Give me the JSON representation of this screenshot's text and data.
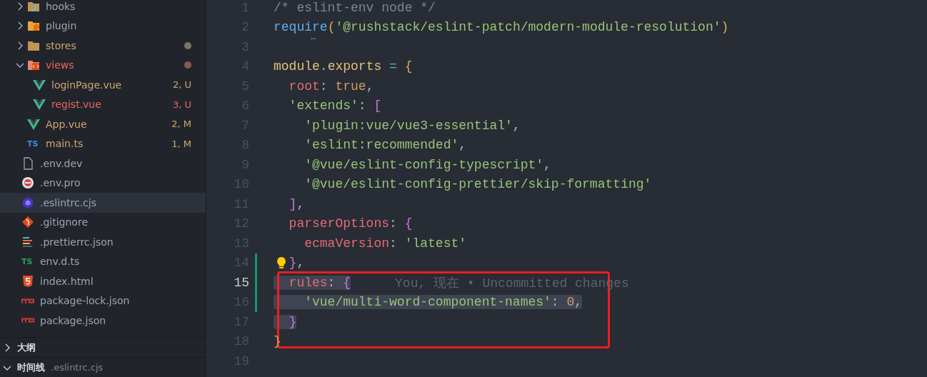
{
  "explorer": {
    "src_items": [
      {
        "name": "hooks",
        "kind": "folder-hooks",
        "expanded": false,
        "color": "#9da5b4"
      },
      {
        "name": "plugin",
        "kind": "folder-plugin",
        "expanded": false,
        "color": "#9da5b4"
      },
      {
        "name": "stores",
        "kind": "folder",
        "expanded": false,
        "color": "#cfa56f",
        "dot": {
          "color": "#7d7565"
        }
      },
      {
        "name": "views",
        "kind": "folder-views",
        "expanded": true,
        "color": "#e8685f",
        "dot": {
          "color": "#8c5852"
        },
        "children": [
          {
            "name": "loginPage.vue",
            "kind": "vue",
            "color": "#cfa56f",
            "badge": "2, U"
          },
          {
            "name": "regist.vue",
            "kind": "vue",
            "color": "#e8685f",
            "badge": "3, U"
          }
        ]
      },
      {
        "name": "App.vue",
        "kind": "vue",
        "color": "#cfa56f",
        "badge": "2, M"
      },
      {
        "name": "main.ts",
        "kind": "ts",
        "icon_text": "TS",
        "color": "#cfa56f",
        "badge": "1, M"
      }
    ],
    "root_items": [
      {
        "name": ".env.dev",
        "kind": "file",
        "selected": false
      },
      {
        "name": ".env.pro",
        "kind": "env-pro",
        "selected": false
      },
      {
        "name": ".eslintrc.cjs",
        "kind": "eslint",
        "selected": true
      },
      {
        "name": ".gitignore",
        "kind": "git",
        "selected": false
      },
      {
        "name": ".prettierrc.json",
        "kind": "prettier",
        "selected": false
      },
      {
        "name": "env.d.ts",
        "kind": "ts-green",
        "icon_text": "TS",
        "selected": false
      },
      {
        "name": "index.html",
        "kind": "html",
        "selected": false
      },
      {
        "name": "package-lock.json",
        "kind": "npm",
        "selected": false
      },
      {
        "name": "package.json",
        "kind": "npm",
        "selected": false
      }
    ]
  },
  "panels": [
    {
      "title": "大纲",
      "expanded": false
    },
    {
      "title": "时间线",
      "expanded": true,
      "subtitle": ".eslintrc.cjs"
    }
  ],
  "editor": {
    "lines": [
      {
        "number": "1",
        "current": false,
        "selected": false,
        "kind": "top",
        "tokens": [
          {
            "text": "/* eslint-env node */",
            "kind": "comment"
          }
        ]
      },
      {
        "number": "2",
        "current": false,
        "selected": false,
        "hint": "…",
        "kind": "top",
        "tokens": [
          {
            "text": "require",
            "kind": "func"
          },
          {
            "text": "(",
            "kind": "paren"
          },
          {
            "text": "'@rushstack/eslint-patch/modern-module-resolution'",
            "kind": "string"
          },
          {
            "text": ")",
            "kind": "paren"
          }
        ]
      },
      {
        "number": "3",
        "current": false
      },
      {
        "number": "4",
        "current": false,
        "selected": false,
        "kind": "top",
        "tokens": [
          {
            "text": "module",
            "kind": "var"
          },
          {
            "text": ".",
            "kind": "punct"
          },
          {
            "text": "exports",
            "kind": "var"
          },
          {
            "text": " = ",
            "kind": "op"
          },
          {
            "text": "{",
            "kind": "brace1"
          }
        ]
      },
      {
        "number": "5",
        "current": false,
        "selected": false,
        "kind": "inner",
        "tokens": [
          {
            "text": "root",
            "kind": "key"
          },
          {
            "text": ": ",
            "kind": "punct"
          },
          {
            "text": "true",
            "kind": "bool"
          },
          {
            "text": ",",
            "kind": "punct"
          }
        ]
      },
      {
        "number": "6",
        "current": false,
        "selected": false,
        "kind": "inner",
        "tokens": [
          {
            "text": "'extends'",
            "kind": "string"
          },
          {
            "text": ": ",
            "kind": "punct"
          },
          {
            "text": "[",
            "kind": "brace2"
          }
        ]
      },
      {
        "number": "7",
        "current": false,
        "selected": false,
        "kind": "deep",
        "tokens": [
          {
            "text": "'plugin:vue/vue3-essential'",
            "kind": "string"
          },
          {
            "text": ",",
            "kind": "punct"
          }
        ]
      },
      {
        "number": "8",
        "current": false,
        "selected": false,
        "kind": "deep",
        "tokens": [
          {
            "text": "'eslint:recommended'",
            "kind": "string"
          },
          {
            "text": ",",
            "kind": "punct"
          }
        ]
      },
      {
        "number": "9",
        "current": false,
        "selected": false,
        "kind": "deep",
        "tokens": [
          {
            "text": "'@vue/eslint-config-typescript'",
            "kind": "string"
          },
          {
            "text": ",",
            "kind": "punct"
          }
        ]
      },
      {
        "number": "10",
        "current": false,
        "selected": false,
        "kind": "deep",
        "tokens": [
          {
            "text": "'@vue/eslint-config-prettier/skip-formatting'",
            "kind": "string"
          }
        ]
      },
      {
        "number": "11",
        "current": false,
        "selected": false,
        "kind": "inner",
        "tokens": [
          {
            "text": "]",
            "kind": "brace2"
          },
          {
            "text": ",",
            "kind": "punct"
          }
        ]
      },
      {
        "number": "12",
        "current": false,
        "selected": false,
        "kind": "inner",
        "tokens": [
          {
            "text": "parserOptions",
            "kind": "key"
          },
          {
            "text": ": ",
            "kind": "punct"
          },
          {
            "text": "{",
            "kind": "brace2"
          }
        ]
      },
      {
        "number": "13",
        "current": false,
        "selected": false,
        "kind": "deep",
        "tokens": [
          {
            "text": "ecmaVersion",
            "kind": "key"
          },
          {
            "text": ": ",
            "kind": "punct"
          },
          {
            "text": "'latest'",
            "kind": "string"
          }
        ]
      },
      {
        "number": "14",
        "current": false,
        "selected": false,
        "lightbulb": true,
        "changed": true,
        "kind": "inner",
        "tokens": [
          {
            "text": "}",
            "kind": "brace2"
          },
          {
            "text": ",",
            "kind": "punct"
          }
        ]
      },
      {
        "number": "15",
        "current": true,
        "selected": true,
        "changed": true,
        "kind": "inner",
        "blame": "You, 现在 • Uncommitted changes",
        "tokens": [
          {
            "text": "rules",
            "kind": "key"
          },
          {
            "text": ": ",
            "kind": "punct"
          },
          {
            "text": "{",
            "kind": "brace2"
          }
        ]
      },
      {
        "number": "16",
        "current": false,
        "selected": true,
        "changed": true,
        "kind": "deep",
        "tokens": [
          {
            "text": "'vue/multi-word-component-names'",
            "kind": "string"
          },
          {
            "text": ": ",
            "kind": "punct"
          },
          {
            "text": "0",
            "kind": "number"
          },
          {
            "text": ",",
            "kind": "punct"
          }
        ]
      },
      {
        "number": "17",
        "current": false,
        "selected": true,
        "kind": "inner",
        "tokens": [
          {
            "text": "}",
            "kind": "brace2"
          }
        ]
      },
      {
        "number": "18",
        "current": false,
        "selected": false,
        "kind": "top",
        "tokens": [
          {
            "text": "}",
            "kind": "brace1"
          }
        ]
      },
      {
        "number": "19",
        "current": false
      }
    ],
    "annotation": {
      "kind": "rectangle"
    }
  }
}
